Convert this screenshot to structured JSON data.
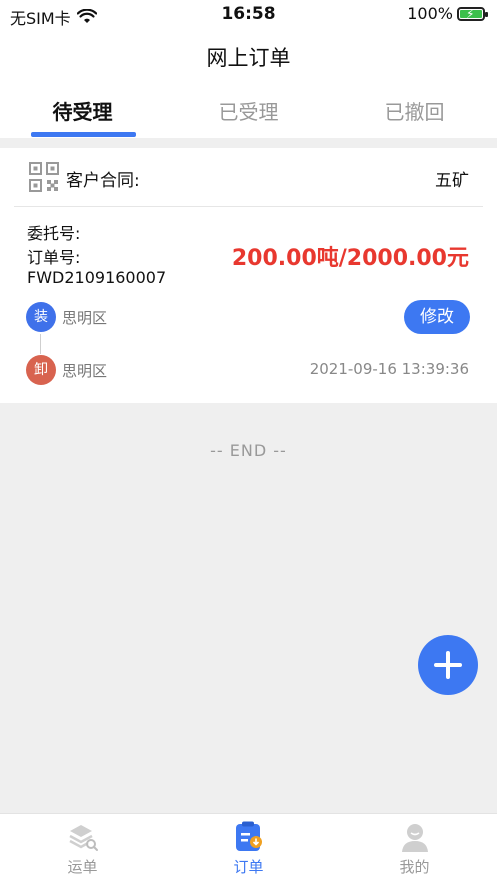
{
  "status_bar": {
    "carrier": "无SIM卡",
    "time": "16:58",
    "battery": "100%"
  },
  "nav": {
    "title": "网上订单"
  },
  "tabs": [
    {
      "label": "待受理",
      "active": true
    },
    {
      "label": "已受理",
      "active": false
    },
    {
      "label": "已撤回",
      "active": false
    }
  ],
  "order": {
    "contract_label": "客户合同:",
    "contract_value": "五矿",
    "consign_label": "委托号:",
    "order_no_label": "订单号:",
    "order_no": "FWD2109160007",
    "price": "200.00吨/2000.00元",
    "load_badge": "装",
    "load_location": "思明区",
    "unload_badge": "卸",
    "unload_location": "思明区",
    "modify_label": "修改",
    "timestamp": "2021-09-16 13:39:36"
  },
  "list_end": "-- END --",
  "tabbar": [
    {
      "label": "运单",
      "icon": "waybill-icon",
      "active": false
    },
    {
      "label": "订单",
      "icon": "order-icon",
      "active": true
    },
    {
      "label": "我的",
      "icon": "profile-icon",
      "active": false
    }
  ],
  "colors": {
    "accent": "#3d78f2",
    "price": "#e8382f",
    "unload_badge": "#d8634f",
    "battery": "#3bbf4b"
  }
}
